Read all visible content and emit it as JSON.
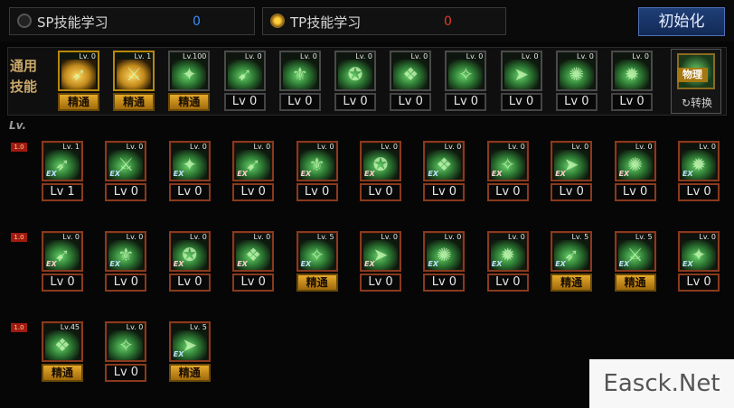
{
  "header": {
    "sp": {
      "label": "SP技能学习",
      "value": "0",
      "value_color": "#3a8cff"
    },
    "tp": {
      "label": "TP技能学习",
      "value": "0",
      "value_color": "#e03a2a"
    },
    "reset_label": "初始化"
  },
  "general": {
    "label": "通用技能",
    "skills": [
      {
        "lv": "Lv. 0",
        "bar": "精通",
        "mastery": true,
        "gold": true
      },
      {
        "lv": "Lv. 1",
        "bar": "精通",
        "mastery": true,
        "gold": true
      },
      {
        "lv": "Lv.100",
        "bar": "精通",
        "mastery": true,
        "gold": false
      },
      {
        "lv": "Lv. 0",
        "bar": "Lv 0",
        "mastery": false,
        "gold": false
      },
      {
        "lv": "Lv. 0",
        "bar": "Lv 0",
        "mastery": false,
        "gold": false
      },
      {
        "lv": "Lv. 0",
        "bar": "Lv 0",
        "mastery": false,
        "gold": false
      },
      {
        "lv": "Lv. 0",
        "bar": "Lv 0",
        "mastery": false,
        "gold": false
      },
      {
        "lv": "Lv. 0",
        "bar": "Lv 0",
        "mastery": false,
        "gold": false
      },
      {
        "lv": "Lv. 0",
        "bar": "Lv 0",
        "mastery": false,
        "gold": false
      },
      {
        "lv": "Lv. 0",
        "bar": "Lv 0",
        "mastery": false,
        "gold": false
      },
      {
        "lv": "Lv. 0",
        "bar": "Lv 0",
        "mastery": false,
        "gold": false
      }
    ],
    "physical_label": "物理",
    "switch_label": "转换"
  },
  "class_skills": {
    "lv_header": "Lv.",
    "row_tag": "1.0",
    "rows": [
      [
        {
          "lv": "Lv. 1",
          "bar": "Lv 1",
          "mastery": false,
          "ex": "EX",
          "ex_color": "blue"
        },
        {
          "lv": "Lv. 0",
          "bar": "Lv 0",
          "mastery": false,
          "ex": "EX",
          "ex_color": "blue"
        },
        {
          "lv": "Lv. 0",
          "bar": "Lv 0",
          "mastery": false,
          "ex": "EX",
          "ex_color": "blue"
        },
        {
          "lv": "Lv. 0",
          "bar": "Lv 0",
          "mastery": false,
          "ex": "EX",
          "ex_color": "red"
        },
        {
          "lv": "Lv. 0",
          "bar": "Lv 0",
          "mastery": false,
          "ex": "EX",
          "ex_color": "red"
        },
        {
          "lv": "Lv. 0",
          "bar": "Lv 0",
          "mastery": false,
          "ex": "EX",
          "ex_color": "red"
        },
        {
          "lv": "Lv. 0",
          "bar": "Lv 0",
          "mastery": false,
          "ex": "EX",
          "ex_color": "blue"
        },
        {
          "lv": "Lv. 0",
          "bar": "Lv 0",
          "mastery": false,
          "ex": "EX",
          "ex_color": "red"
        },
        {
          "lv": "Lv. 0",
          "bar": "Lv 0",
          "mastery": false,
          "ex": "EX",
          "ex_color": "red"
        },
        {
          "lv": "Lv. 0",
          "bar": "Lv 0",
          "mastery": false,
          "ex": "EX",
          "ex_color": "red"
        },
        {
          "lv": "Lv. 0",
          "bar": "Lv 0",
          "mastery": false,
          "ex": "EX",
          "ex_color": "blue"
        }
      ],
      [
        {
          "lv": "Lv. 0",
          "bar": "Lv 0",
          "mastery": false,
          "ex": "EX",
          "ex_color": "red"
        },
        {
          "lv": "Lv. 0",
          "bar": "Lv 0",
          "mastery": false,
          "ex": "EX",
          "ex_color": "blue"
        },
        {
          "lv": "Lv. 0",
          "bar": "Lv 0",
          "mastery": false,
          "ex": "EX",
          "ex_color": "red"
        },
        {
          "lv": "Lv. 0",
          "bar": "Lv 0",
          "mastery": false,
          "ex": "EX",
          "ex_color": "red"
        },
        {
          "lv": "Lv. 5",
          "bar": "精通",
          "mastery": true,
          "ex": "EX",
          "ex_color": "blue"
        },
        {
          "lv": "Lv. 0",
          "bar": "Lv 0",
          "mastery": false,
          "ex": "EX",
          "ex_color": "red"
        },
        {
          "lv": "Lv. 0",
          "bar": "Lv 0",
          "mastery": false,
          "ex": "EX",
          "ex_color": "blue"
        },
        {
          "lv": "Lv. 0",
          "bar": "Lv 0",
          "mastery": false,
          "ex": "EX",
          "ex_color": "blue"
        },
        {
          "lv": "Lv. 5",
          "bar": "精通",
          "mastery": true,
          "ex": "EX",
          "ex_color": "blue"
        },
        {
          "lv": "Lv. 5",
          "bar": "精通",
          "mastery": true,
          "ex": "EX",
          "ex_color": "blue"
        },
        {
          "lv": "Lv. 0",
          "bar": "Lv 0",
          "mastery": false,
          "ex": "EX",
          "ex_color": "blue"
        }
      ],
      [
        {
          "lv": "Lv.45",
          "bar": "精通",
          "mastery": true,
          "ex": "",
          "ex_color": ""
        },
        {
          "lv": "Lv. 0",
          "bar": "Lv 0",
          "mastery": false,
          "ex": "",
          "ex_color": ""
        },
        {
          "lv": "Lv. 5",
          "bar": "精通",
          "mastery": true,
          "ex": "EX",
          "ex_color": "blue"
        }
      ]
    ]
  },
  "watermark": "Easck.Net"
}
